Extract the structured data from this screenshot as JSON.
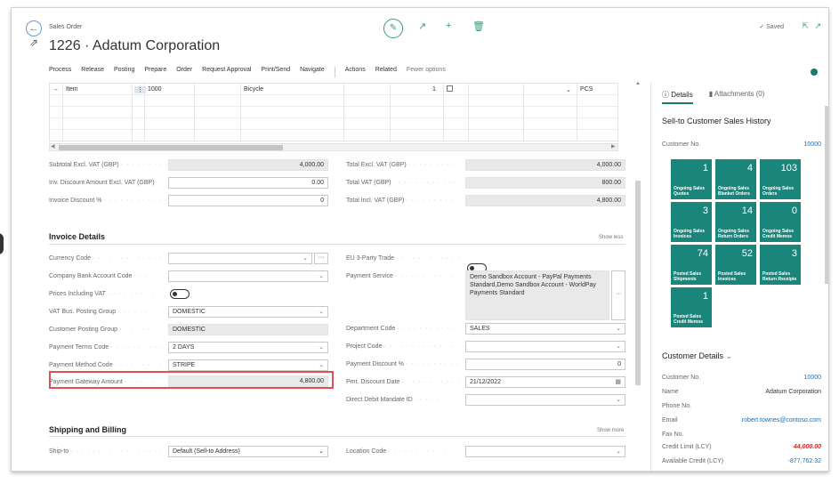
{
  "header": {
    "breadcrumb": "Sales Order",
    "title": "1226 · Adatum Corporation",
    "saved": "Saved"
  },
  "actions": [
    "Process",
    "Release",
    "Posting",
    "Prepare",
    "Order",
    "Request Approval",
    "Print/Send",
    "Navigate"
  ],
  "actions2": [
    "Actions",
    "Related",
    "Fewer options"
  ],
  "lines": {
    "row": {
      "type": "Item",
      "no": "1000",
      "description": "Bicycle",
      "quantity": "1",
      "uom": "PCS"
    }
  },
  "totals": {
    "subtotal_label": "Subtotal Excl. VAT (GBP)",
    "subtotal_value": "4,000.00",
    "invdisc_amt_label": "Inv. Discount Amount Excl. VAT (GBP)",
    "invdisc_amt_value": "0.00",
    "invdisc_pct_label": "Invoice Discount %",
    "invdisc_pct_value": "0",
    "total_excl_label": "Total Excl. VAT (GBP)",
    "total_excl_value": "4,000.00",
    "total_vat_label": "Total VAT (GBP)",
    "total_vat_value": "800.00",
    "total_incl_label": "Total Incl. VAT (GBP)",
    "total_incl_value": "4,800.00"
  },
  "invoice": {
    "title": "Invoice Details",
    "show_less": "Show less",
    "currency_label": "Currency Code",
    "bank_label": "Company Bank Account Code",
    "prices_vat_label": "Prices Including VAT",
    "vat_bus_label": "VAT Bus. Posting Group",
    "vat_bus_value": "DOMESTIC",
    "cust_post_label": "Customer Posting Group",
    "cust_post_value": "DOMESTIC",
    "pay_terms_label": "Payment Terms Code",
    "pay_terms_value": "2 DAYS",
    "pay_method_label": "Payment Method Code",
    "pay_method_value": "STRIPE",
    "gateway_label": "Payment Gateway Amount",
    "gateway_value": "4,800.00",
    "eu3_label": "EU 3-Party Trade",
    "pay_service_label": "Payment Service",
    "pay_service_value": "Demo Sandbox Account - PayPal Payments Standard,Demo Sandbox Account - WorldPay Payments Standard",
    "dept_label": "Department Code",
    "dept_value": "SALES",
    "project_label": "Project Code",
    "pay_disc_label": "Payment Discount %",
    "pay_disc_value": "0",
    "pmt_disc_date_label": "Pmt. Discount Date",
    "pmt_disc_date_value": "21/12/2022",
    "dd_label": "Direct Debit Mandate ID"
  },
  "shipping": {
    "title": "Shipping and Billing",
    "show_more": "Show more",
    "shipto_label": "Ship-to",
    "shipto_value": "Default (Sell-to Address)",
    "location_label": "Location Code"
  },
  "pane": {
    "tab_details": "Details",
    "tab_attachments": "Attachments (0)",
    "history_title": "Sell-to Customer Sales History",
    "custno_label": "Customer No.",
    "custno_value": "10000",
    "tiles": [
      {
        "value": "1",
        "label": "Ongoing Sales Quotes"
      },
      {
        "value": "4",
        "label": "Ongoing Sales Blanket Orders"
      },
      {
        "value": "103",
        "label": "Ongoing Sales Orders"
      },
      {
        "value": "3",
        "label": "Ongoing Sales Invoices"
      },
      {
        "value": "14",
        "label": "Ongoing Sales Return Orders"
      },
      {
        "value": "0",
        "label": "Ongoing Sales Credit Memos"
      },
      {
        "value": "74",
        "label": "Posted Sales Shipments"
      },
      {
        "value": "52",
        "label": "Posted Sales Invoices"
      },
      {
        "value": "3",
        "label": "Posted Sales Return Receipts"
      },
      {
        "value": "1",
        "label": "Posted Sales Credit Memos"
      }
    ],
    "cust_details_title": "Customer Details",
    "cd": {
      "no_label": "Customer No.",
      "no_value": "10000",
      "name_label": "Name",
      "name_value": "Adatum Corporation",
      "phone_label": "Phone No.",
      "email_label": "Email",
      "email_value": "robert.townes@contoso.com",
      "fax_label": "Fax No.",
      "credit_label": "Credit Limit (LCY)",
      "credit_value": "44,000.00",
      "avail_label": "Available Credit (LCY)",
      "avail_value": "-877,762.32"
    }
  },
  "colors": {
    "accent": "#1a857a",
    "highlight": "#e05050",
    "link": "#1a6fb5"
  }
}
